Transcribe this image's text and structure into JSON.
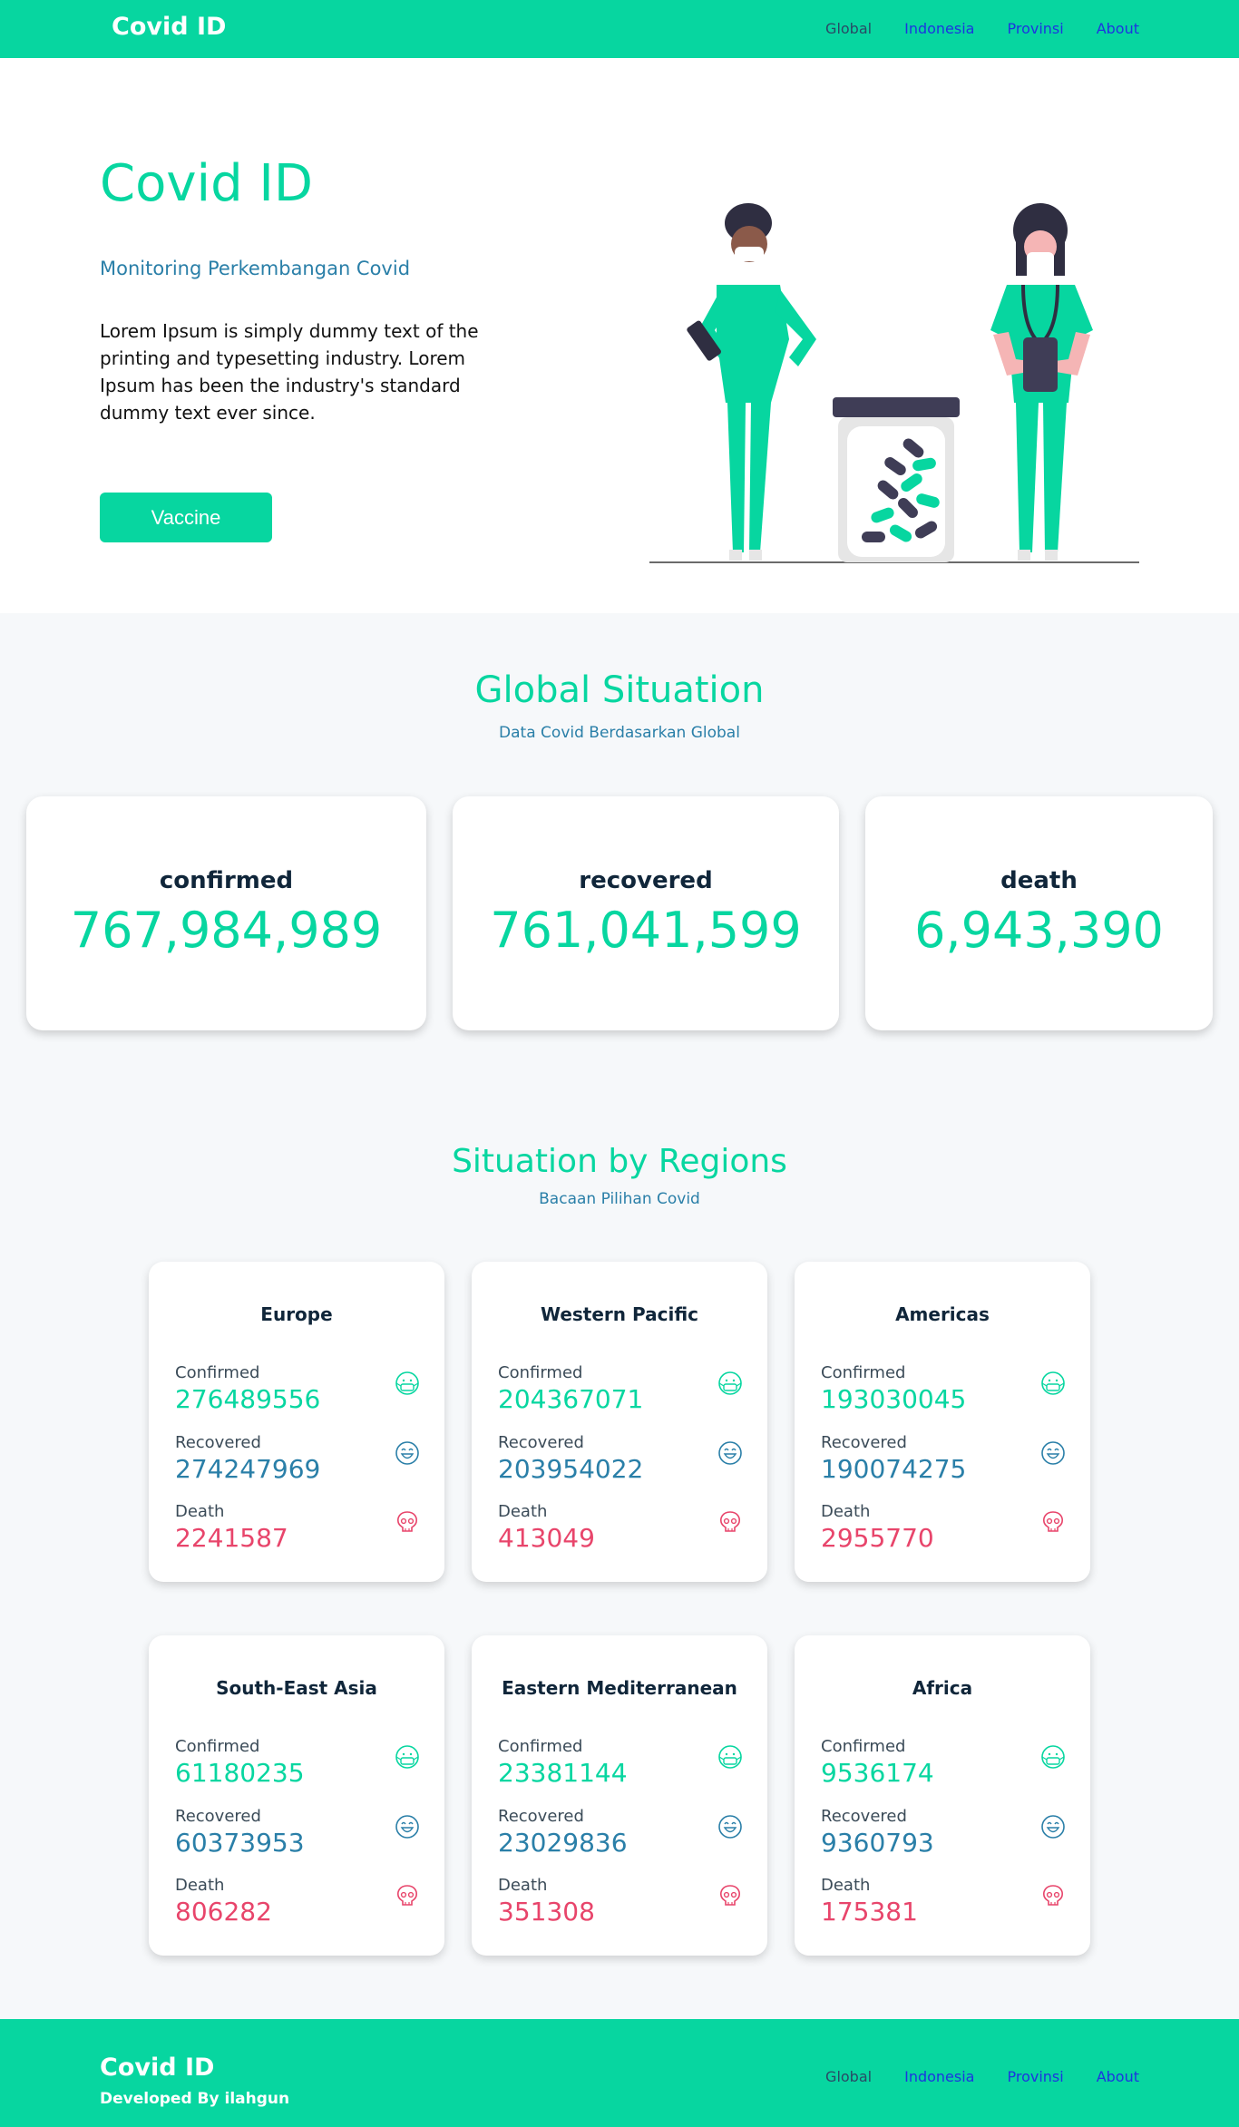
{
  "nav": {
    "brand": "Covid ID",
    "links": [
      {
        "label": "Global"
      },
      {
        "label": "Indonesia"
      },
      {
        "label": "Provinsi"
      },
      {
        "label": "About"
      }
    ]
  },
  "hero": {
    "title": "Covid ID",
    "subtitle": "Monitoring Perkembangan Covid",
    "text": "Lorem Ipsum is simply dummy text of the printing and typesetting industry. Lorem Ipsum has been the industry's standard dummy text ever since.",
    "button_label": "Vaccine"
  },
  "global": {
    "title": "Global Situation",
    "subtitle": "Data Covid Berdasarkan Global",
    "cards": [
      {
        "label": "confirmed",
        "value": "767,984,989"
      },
      {
        "label": "recovered",
        "value": "761,041,599"
      },
      {
        "label": "death",
        "value": "6,943,390"
      }
    ]
  },
  "regions": {
    "title": "Situation by Regions",
    "subtitle": "Bacaan Pilihan Covid",
    "labels": {
      "confirmed": "Confirmed",
      "recovered": "Recovered",
      "death": "Death"
    },
    "items": [
      {
        "name": "Europe",
        "confirmed": "276489556",
        "recovered": "274247969",
        "death": "2241587"
      },
      {
        "name": "Western Pacific",
        "confirmed": "204367071",
        "recovered": "203954022",
        "death": "413049"
      },
      {
        "name": "Americas",
        "confirmed": "193030045",
        "recovered": "190074275",
        "death": "2955770"
      },
      {
        "name": "South-East Asia",
        "confirmed": "61180235",
        "recovered": "60373953",
        "death": "806282"
      },
      {
        "name": "Eastern Mediterranean",
        "confirmed": "23381144",
        "recovered": "23029836",
        "death": "351308"
      },
      {
        "name": "Africa",
        "confirmed": "9536174",
        "recovered": "9360793",
        "death": "175381"
      }
    ]
  },
  "footer": {
    "brand": "Covid ID",
    "developer": "Developed By ilahgun"
  },
  "colors": {
    "accent": "#07d6a0",
    "blue": "#2a7fa8",
    "red": "#e8456b",
    "nav_link": "#1d35e0"
  },
  "icons": {
    "confirmed": "mask-face-icon",
    "recovered": "happy-face-icon",
    "death": "skull-icon"
  }
}
